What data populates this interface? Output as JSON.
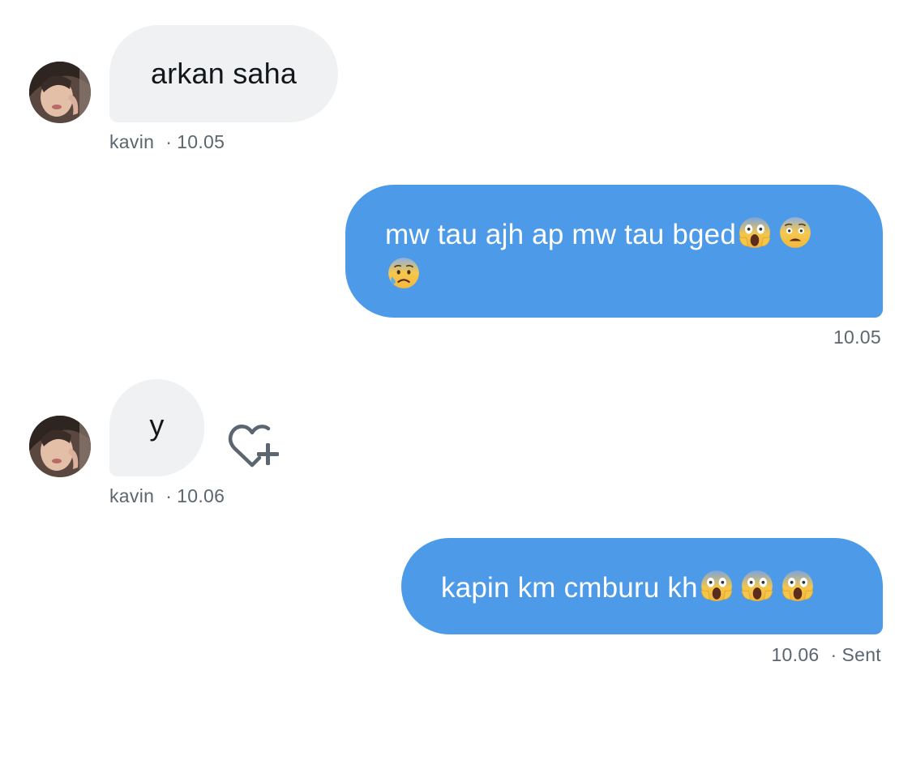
{
  "messages": [
    {
      "direction": "incoming",
      "sender": "kavin",
      "text": "arkan saha",
      "time": "10.05",
      "emojis": []
    },
    {
      "direction": "outgoing",
      "line1": "mw tau ajh ap mw tau bged",
      "emojis_line1": [
        "screaming-in-fear-emoji",
        "fearful-face-emoji"
      ],
      "emojis_line2": [
        "anxious-face-with-sweat-emoji"
      ],
      "time": "10.05"
    },
    {
      "direction": "incoming",
      "sender": "kavin",
      "text": "y",
      "time": "10.06",
      "reaction_icon": "heart-plus-icon"
    },
    {
      "direction": "outgoing",
      "text": "kapin km cmburu kh",
      "emojis": [
        "screaming-in-fear-emoji",
        "screaming-in-fear-emoji",
        "screaming-in-fear-emoji"
      ],
      "time": "10.06",
      "status": "Sent"
    }
  ],
  "separator": "·",
  "colors": {
    "incoming_bubble": "#eff1f3",
    "outgoing_bubble": "#4c9ae8",
    "meta_text": "#5b6670"
  }
}
